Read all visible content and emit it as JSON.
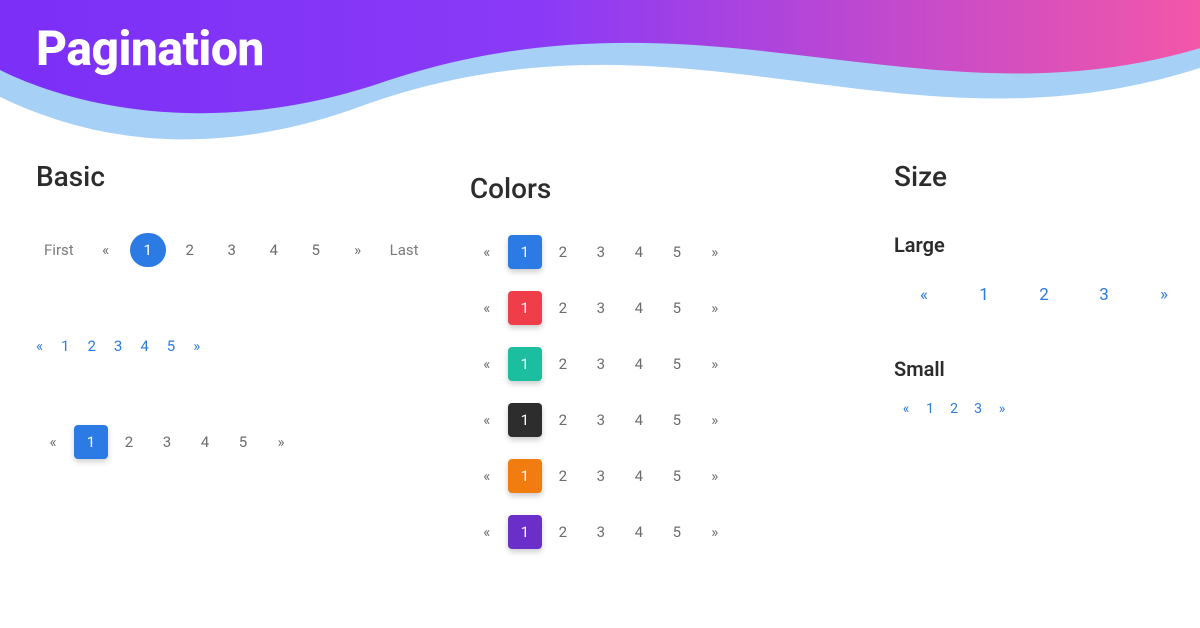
{
  "title": "Pagination",
  "sections": {
    "basic": {
      "heading": "Basic"
    },
    "colors": {
      "heading": "Colors"
    },
    "size": {
      "heading": "Size",
      "large_label": "Large",
      "small_label": "Small"
    }
  },
  "labels": {
    "first": "First",
    "last": "Last",
    "prev": "«",
    "next": "»"
  },
  "pages5": [
    "1",
    "2",
    "3",
    "4",
    "5"
  ],
  "pages3": [
    "1",
    "2",
    "3"
  ],
  "colors": {
    "primary": "#2c7be5",
    "danger": "#ef3e4a",
    "teal": "#1bbfa0",
    "dark": "#2d2d2d",
    "warning": "#f17d11",
    "purple": "#6b2fc9",
    "link": "#2c7be5"
  }
}
